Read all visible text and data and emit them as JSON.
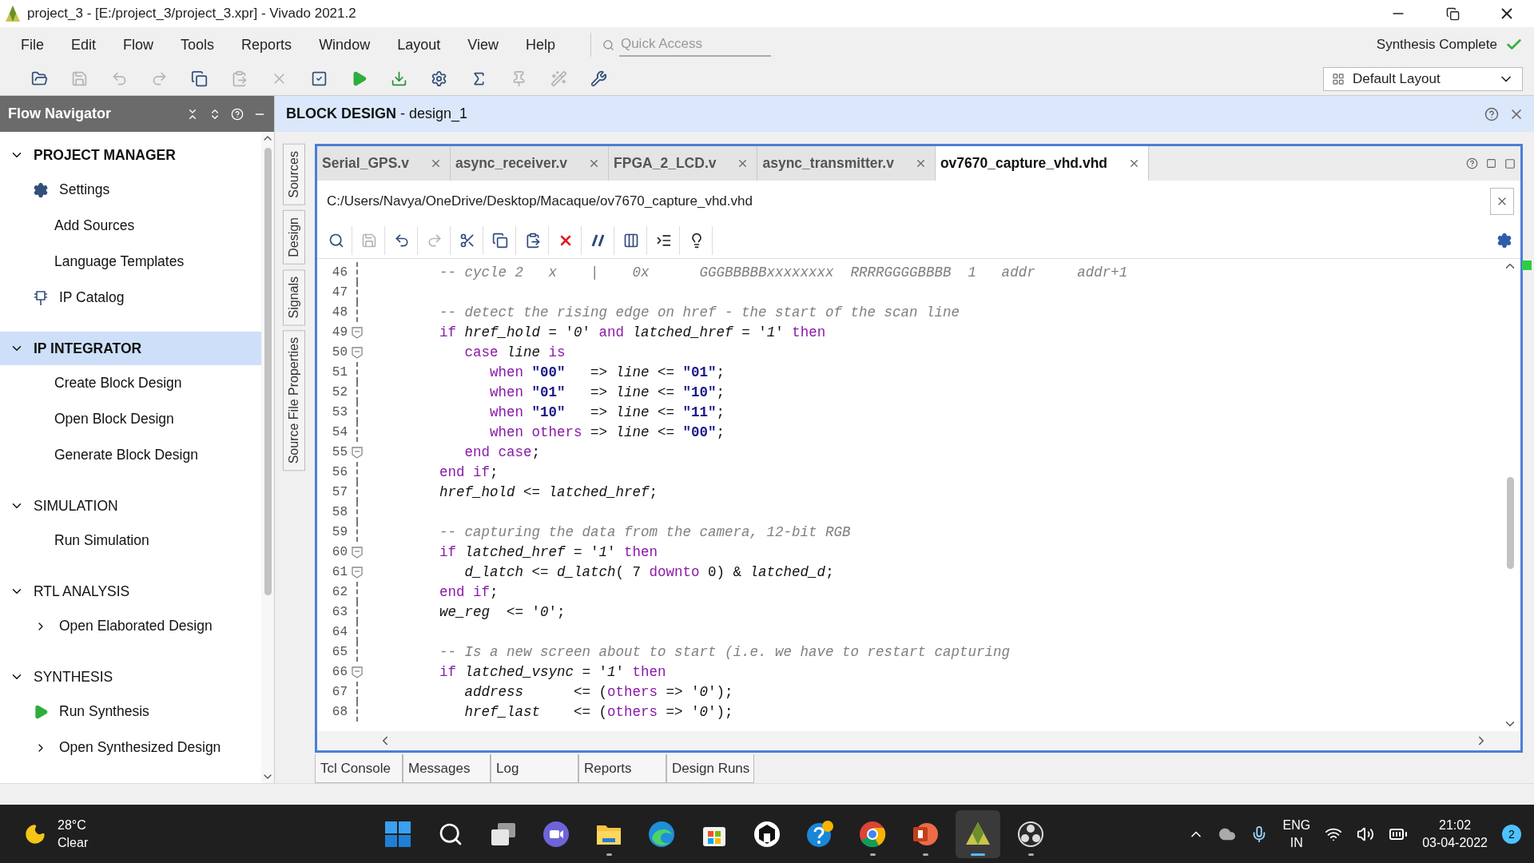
{
  "window": {
    "title": "project_3 - [E:/project_3/project_3.xpr] - Vivado 2021.2"
  },
  "menu": [
    "File",
    "Edit",
    "Flow",
    "Tools",
    "Reports",
    "Window",
    "Layout",
    "View",
    "Help"
  ],
  "quick_access": {
    "placeholder": "Quick Access"
  },
  "status": {
    "text": "Synthesis Complete",
    "done": true
  },
  "toolbar": [
    {
      "kind": "open",
      "disabled": false
    },
    {
      "kind": "save",
      "disabled": true
    },
    {
      "kind": "undo",
      "disabled": true
    },
    {
      "kind": "redo",
      "disabled": true
    },
    {
      "kind": "copy",
      "disabled": false
    },
    {
      "kind": "paste",
      "disabled": true
    },
    {
      "kind": "delete",
      "disabled": true
    },
    {
      "kind": "check",
      "disabled": false
    },
    {
      "kind": "run",
      "disabled": false
    },
    {
      "kind": "program",
      "disabled": false
    },
    {
      "kind": "settings",
      "disabled": false
    },
    {
      "kind": "sigma",
      "disabled": false
    },
    {
      "kind": "pin",
      "disabled": true
    },
    {
      "kind": "wand",
      "disabled": true
    },
    {
      "kind": "tool",
      "disabled": false
    }
  ],
  "layout_select": {
    "value": "Default Layout"
  },
  "flow_navigator": {
    "title": "Flow Navigator",
    "sections": [
      {
        "title": "PROJECT MANAGER",
        "bold": true,
        "selected": false,
        "expanded": true,
        "items": [
          {
            "label": "Settings",
            "kind": "settings"
          },
          {
            "label": "Add Sources",
            "kind": "plain"
          },
          {
            "label": "Language Templates",
            "kind": "plain"
          },
          {
            "label": "IP Catalog",
            "kind": "catalog"
          }
        ]
      },
      {
        "title": "IP INTEGRATOR",
        "bold": true,
        "selected": true,
        "expanded": true,
        "items": [
          {
            "label": "Create Block Design",
            "kind": "plain"
          },
          {
            "label": "Open Block Design",
            "kind": "plain"
          },
          {
            "label": "Generate Block Design",
            "kind": "plain"
          }
        ]
      },
      {
        "title": "SIMULATION",
        "bold": false,
        "selected": false,
        "expanded": true,
        "items": [
          {
            "label": "Run Simulation",
            "kind": "plain"
          }
        ]
      },
      {
        "title": "RTL ANALYSIS",
        "bold": false,
        "selected": false,
        "expanded": true,
        "items": [
          {
            "label": "Open Elaborated Design",
            "kind": "group",
            "expanded": false
          }
        ]
      },
      {
        "title": "SYNTHESIS",
        "bold": false,
        "selected": false,
        "expanded": true,
        "items": [
          {
            "label": "Run Synthesis",
            "kind": "run"
          },
          {
            "label": "Open Synthesized Design",
            "kind": "group",
            "expanded": false
          }
        ]
      }
    ]
  },
  "panel_header": {
    "title": "**BLOCK DESIGN** - design_1"
  },
  "side_tabs": [
    "Sources",
    "Design",
    "Signals",
    "Source File Properties"
  ],
  "editor": {
    "tabs": [
      {
        "label": "Serial_GPS.v",
        "selected": false
      },
      {
        "label": "async_receiver.v",
        "selected": false
      },
      {
        "label": "FPGA_2_LCD.v",
        "selected": false
      },
      {
        "label": "async_transmitter.v",
        "selected": false
      },
      {
        "label": "ov7670_capture_vhd.vhd",
        "selected": true
      }
    ],
    "path": "C:/Users/Navya/OneDrive/Desktop/Macaque/ov7670_capture_vhd.vhd",
    "tools": [
      {
        "kind": "search",
        "disabled": false
      },
      {
        "kind": "save",
        "disabled": true
      },
      {
        "kind": "undo",
        "disabled": false
      },
      {
        "kind": "redo",
        "disabled": true
      },
      {
        "kind": "cut",
        "disabled": false
      },
      {
        "kind": "copy",
        "disabled": false
      },
      {
        "kind": "paste",
        "disabled": false
      },
      {
        "kind": "delete",
        "disabled": false
      },
      {
        "kind": "comment",
        "disabled": false
      },
      {
        "kind": "columns",
        "disabled": false
      },
      {
        "kind": "indent",
        "disabled": false
      },
      {
        "kind": "bulb",
        "disabled": false
      }
    ],
    "lines": [
      {
        "number": "46",
        "fold": false,
        "tokens": [
          {
            "kind": "comment",
            "text": "      -- cycle 2   x    |    0x      GGGBBBBBxxxxxxxx  RRRRGGGGBBBB  1   addr     addr+1"
          }
        ]
      },
      {
        "number": "47",
        "fold": false
      },
      {
        "number": "48",
        "fold": false,
        "tokens": [
          {
            "kind": "comment",
            "text": "      -- detect the rising edge on href - the start of the scan line"
          }
        ]
      },
      {
        "number": "49",
        "fold": true,
        "tokens": [
          {
            "kind": "keyword",
            "text": "      if "
          },
          {
            "kind": "name",
            "text": "href_hold"
          },
          {
            "kind": "plain",
            "text": " = '"
          },
          {
            "kind": "name",
            "text": "0"
          },
          {
            "kind": "plain",
            "text": "' "
          },
          {
            "kind": "keyword",
            "text": "and "
          },
          {
            "kind": "name",
            "text": "latched_href"
          },
          {
            "kind": "plain",
            "text": " = '"
          },
          {
            "kind": "name",
            "text": "1"
          },
          {
            "kind": "plain",
            "text": "' "
          },
          {
            "kind": "keyword",
            "text": "then"
          }
        ]
      },
      {
        "number": "50",
        "fold": true,
        "tokens": [
          {
            "kind": "keyword",
            "text": "         case "
          },
          {
            "kind": "name",
            "text": "line"
          },
          {
            "kind": "keyword",
            "text": " is"
          }
        ]
      },
      {
        "number": "51",
        "fold": false,
        "tokens": [
          {
            "kind": "keyword",
            "text": "            when "
          },
          {
            "kind": "string",
            "text": "\"00\""
          },
          {
            "kind": "plain",
            "text": "   => "
          },
          {
            "kind": "name",
            "text": "line"
          },
          {
            "kind": "plain",
            "text": " <= "
          },
          {
            "kind": "string",
            "text": "\"01\""
          },
          {
            "kind": "plain",
            "text": ";"
          }
        ]
      },
      {
        "number": "52",
        "fold": false,
        "tokens": [
          {
            "kind": "keyword",
            "text": "            when "
          },
          {
            "kind": "string",
            "text": "\"01\""
          },
          {
            "kind": "plain",
            "text": "   => "
          },
          {
            "kind": "name",
            "text": "line"
          },
          {
            "kind": "plain",
            "text": " <= "
          },
          {
            "kind": "string",
            "text": "\"10\""
          },
          {
            "kind": "plain",
            "text": ";"
          }
        ]
      },
      {
        "number": "53",
        "fold": false,
        "tokens": [
          {
            "kind": "keyword",
            "text": "            when "
          },
          {
            "kind": "string",
            "text": "\"10\""
          },
          {
            "kind": "plain",
            "text": "   => "
          },
          {
            "kind": "name",
            "text": "line"
          },
          {
            "kind": "plain",
            "text": " <= "
          },
          {
            "kind": "string",
            "text": "\"11\""
          },
          {
            "kind": "plain",
            "text": ";"
          }
        ]
      },
      {
        "number": "54",
        "fold": false,
        "tokens": [
          {
            "kind": "keyword",
            "text": "            when others"
          },
          {
            "kind": "plain",
            "text": " => "
          },
          {
            "kind": "name",
            "text": "line"
          },
          {
            "kind": "plain",
            "text": " <= "
          },
          {
            "kind": "string",
            "text": "\"00\""
          },
          {
            "kind": "plain",
            "text": ";"
          }
        ]
      },
      {
        "number": "55",
        "fold": true,
        "tokens": [
          {
            "kind": "keyword",
            "text": "         end case"
          },
          {
            "kind": "plain",
            "text": ";"
          }
        ]
      },
      {
        "number": "56",
        "fold": false,
        "tokens": [
          {
            "kind": "keyword",
            "text": "      end if"
          },
          {
            "kind": "plain",
            "text": ";"
          }
        ]
      },
      {
        "number": "57",
        "fold": false,
        "tokens": [
          {
            "kind": "name",
            "text": "      href_hold"
          },
          {
            "kind": "plain",
            "text": " <= "
          },
          {
            "kind": "name",
            "text": "latched_href"
          },
          {
            "kind": "plain",
            "text": ";"
          }
        ]
      },
      {
        "number": "58",
        "fold": false
      },
      {
        "number": "59",
        "fold": false,
        "tokens": [
          {
            "kind": "comment",
            "text": "      -- capturing the data from the camera, 12-bit RGB"
          }
        ]
      },
      {
        "number": "60",
        "fold": true,
        "tokens": [
          {
            "kind": "keyword",
            "text": "      if "
          },
          {
            "kind": "name",
            "text": "latched_href"
          },
          {
            "kind": "plain",
            "text": " = '"
          },
          {
            "kind": "name",
            "text": "1"
          },
          {
            "kind": "plain",
            "text": "' "
          },
          {
            "kind": "keyword",
            "text": "then"
          }
        ]
      },
      {
        "number": "61",
        "fold": true,
        "tokens": [
          {
            "kind": "name",
            "text": "         d_latch"
          },
          {
            "kind": "plain",
            "text": " <= "
          },
          {
            "kind": "name",
            "text": "d_latch"
          },
          {
            "kind": "plain",
            "text": "( 7 "
          },
          {
            "kind": "keyword",
            "text": "downto"
          },
          {
            "kind": "plain",
            "text": " 0) & "
          },
          {
            "kind": "name",
            "text": "latched_d"
          },
          {
            "kind": "plain",
            "text": ";"
          }
        ]
      },
      {
        "number": "62",
        "fold": false,
        "tokens": [
          {
            "kind": "keyword",
            "text": "      end if"
          },
          {
            "kind": "plain",
            "text": ";"
          }
        ]
      },
      {
        "number": "63",
        "fold": false,
        "tokens": [
          {
            "kind": "name",
            "text": "      we_reg"
          },
          {
            "kind": "plain",
            "text": "  <= '"
          },
          {
            "kind": "name",
            "text": "0"
          },
          {
            "kind": "plain",
            "text": "';"
          }
        ]
      },
      {
        "number": "64",
        "fold": false
      },
      {
        "number": "65",
        "fold": false,
        "tokens": [
          {
            "kind": "comment",
            "text": "      -- Is a new screen about to start (i.e. we have to restart capturing"
          }
        ]
      },
      {
        "number": "66",
        "fold": true,
        "tokens": [
          {
            "kind": "keyword",
            "text": "      if "
          },
          {
            "kind": "name",
            "text": "latched_vsync"
          },
          {
            "kind": "plain",
            "text": " = '"
          },
          {
            "kind": "name",
            "text": "1"
          },
          {
            "kind": "plain",
            "text": "' "
          },
          {
            "kind": "keyword",
            "text": "then"
          }
        ]
      },
      {
        "number": "67",
        "fold": false,
        "tokens": [
          {
            "kind": "name",
            "text": "         address"
          },
          {
            "kind": "plain",
            "text": "      <= ("
          },
          {
            "kind": "keyword",
            "text": "others"
          },
          {
            "kind": "plain",
            "text": " => '"
          },
          {
            "kind": "name",
            "text": "0"
          },
          {
            "kind": "plain",
            "text": "');"
          }
        ]
      },
      {
        "number": "68",
        "fold": false,
        "tokens": [
          {
            "kind": "name",
            "text": "         href_last"
          },
          {
            "kind": "plain",
            "text": "    <= ("
          },
          {
            "kind": "keyword",
            "text": "others"
          },
          {
            "kind": "plain",
            "text": " => '"
          },
          {
            "kind": "name",
            "text": "0"
          },
          {
            "kind": "plain",
            "text": "');"
          }
        ]
      }
    ]
  },
  "bottom_tabs": [
    {
      "label": "Tcl Console",
      "selected": false
    },
    {
      "label": "Messages",
      "selected": false
    },
    {
      "label": "Log",
      "selected": false
    },
    {
      "label": "Reports",
      "selected": false
    },
    {
      "label": "Design Runs",
      "selected": false
    }
  ],
  "taskbar": {
    "weather": {
      "temp": "28°C",
      "condition": "Clear"
    },
    "apps": [
      {
        "kind": "start",
        "running": false,
        "selected": false
      },
      {
        "kind": "search",
        "running": false,
        "selected": false
      },
      {
        "kind": "taskview",
        "running": false,
        "selected": false
      },
      {
        "kind": "chat",
        "running": false,
        "selected": false
      },
      {
        "kind": "folder",
        "running": true,
        "selected": false
      },
      {
        "kind": "edge",
        "running": false,
        "selected": false
      },
      {
        "kind": "store",
        "running": false,
        "selected": false
      },
      {
        "kind": "hexagon",
        "running": false,
        "selected": false
      },
      {
        "kind": "help",
        "running": false,
        "selected": false
      },
      {
        "kind": "chrome",
        "running": true,
        "selected": false
      },
      {
        "kind": "slides",
        "running": true,
        "selected": false
      },
      {
        "kind": "vivado",
        "running": true,
        "selected": true
      },
      {
        "kind": "obs",
        "running": true,
        "selected": false
      }
    ],
    "language": "ENG",
    "region": "IN",
    "time": "21:02",
    "date": "03-04-2022",
    "notifications": "2"
  }
}
